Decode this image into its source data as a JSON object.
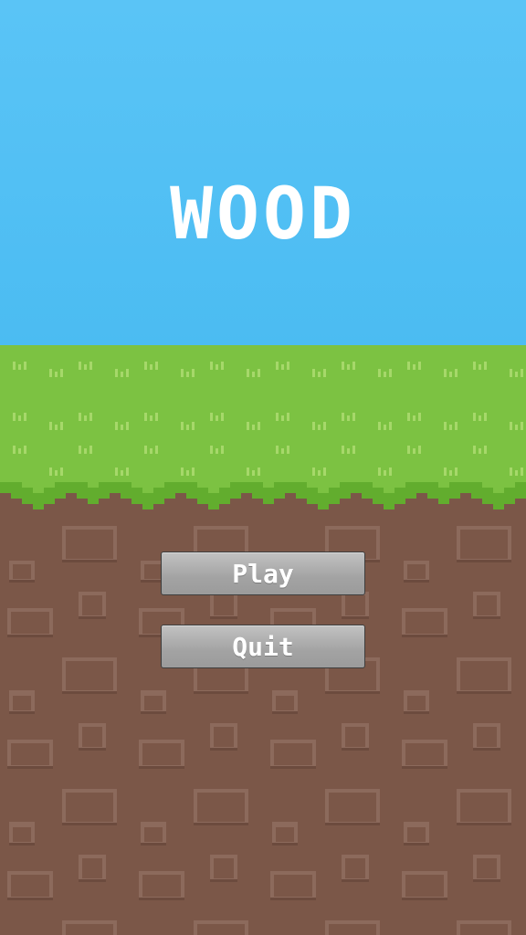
{
  "title": "WOOD",
  "menu": {
    "play_label": "Play",
    "quit_label": "Quit"
  },
  "colors": {
    "sky": "#55c1f4",
    "grass": "#7cc242",
    "grass_dark": "#62ad2e",
    "grass_tuft": "#a6d86a",
    "dirt": "#7b5748",
    "dirt_rock": "#8c6a5c",
    "dirt_shadow": "#6c4b3e",
    "button": "#a6a6a6",
    "text": "#ffffff"
  }
}
